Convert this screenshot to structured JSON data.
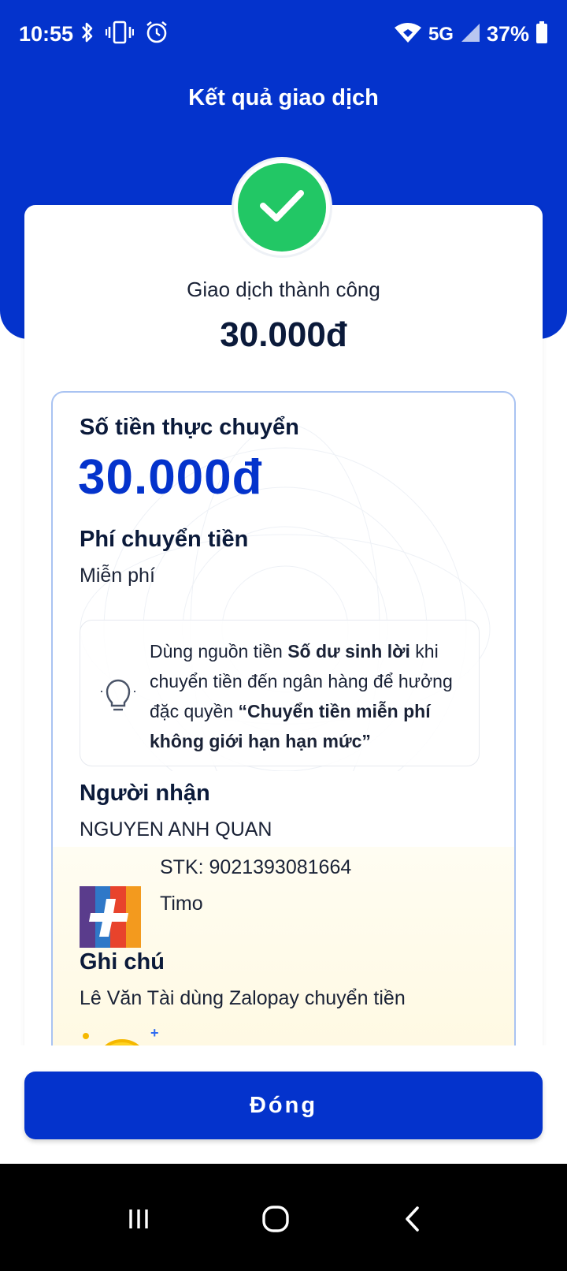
{
  "status_bar": {
    "time": "10:55",
    "network": "5G",
    "battery": "37%"
  },
  "header": {
    "title": "Kết quả giao dịch"
  },
  "result": {
    "status": "Giao dịch thành công",
    "amount": "30.000đ"
  },
  "details": {
    "actual_amount_label": "Số tiền thực chuyển",
    "actual_amount": "30.000đ",
    "fee_label": "Phí chuyển tiền",
    "fee_value": "Miễn phí",
    "tip": {
      "part1": "Dùng nguồn tiền ",
      "bold1": "Số dư sinh lời",
      "part2": " khi chuyển tiền đến ngân hàng để hưởng đặc quyền ",
      "bold2": "“Chuyển tiền miễn phí không giới hạn hạn mức”",
      "icon": "lightbulb-icon"
    },
    "recipient_label": "Người nhận",
    "recipient_name": "NGUYEN ANH QUAN",
    "account_number": "STK: 9021393081664",
    "bank_name": "Timo",
    "note_label": "Ghi chú",
    "note_value": "Lê Văn Tài dùng Zalopay chuyển tiền"
  },
  "actions": {
    "close_label": "Đóng"
  },
  "colors": {
    "primary": "#0433cc",
    "success": "#22c765",
    "border": "#a9c3f2"
  }
}
